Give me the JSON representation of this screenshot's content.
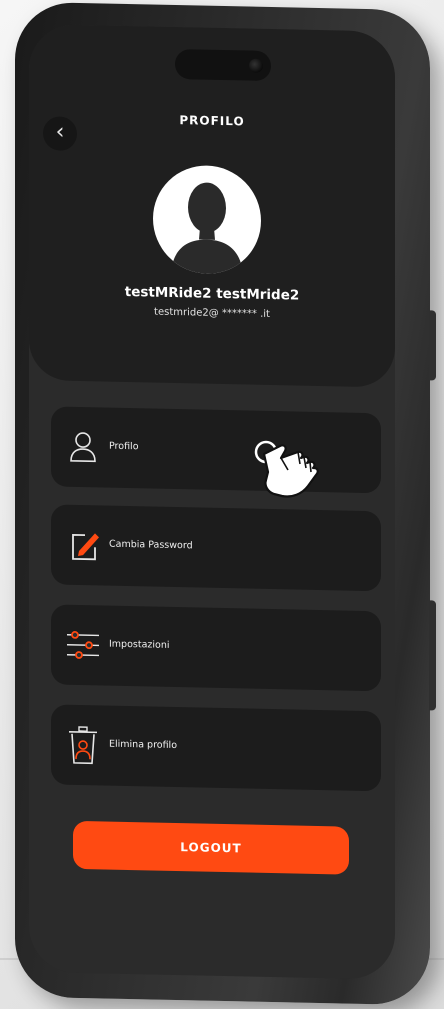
{
  "header": {
    "title": "PROFILO",
    "back_icon": "chevron-left-icon"
  },
  "user": {
    "name": "testMRide2 testMride2",
    "email": "testmride2@ ******* .it",
    "avatar_icon": "user-silhouette-icon"
  },
  "menu": {
    "items": [
      {
        "label": "Profilo",
        "icon": "user-outline-icon"
      },
      {
        "label": "Cambia Password",
        "icon": "edit-pencil-icon"
      },
      {
        "label": "Impostazioni",
        "icon": "sliders-icon"
      },
      {
        "label": "Elimina profilo",
        "icon": "trash-user-icon"
      }
    ]
  },
  "logout": {
    "label": "LOGOUT"
  },
  "colors": {
    "accent": "#FF4A12",
    "card_background": "#1C1C1C",
    "screen_background": "#2B2B2B"
  },
  "overlay": {
    "pointer_icon": "tap-hand-icon"
  }
}
